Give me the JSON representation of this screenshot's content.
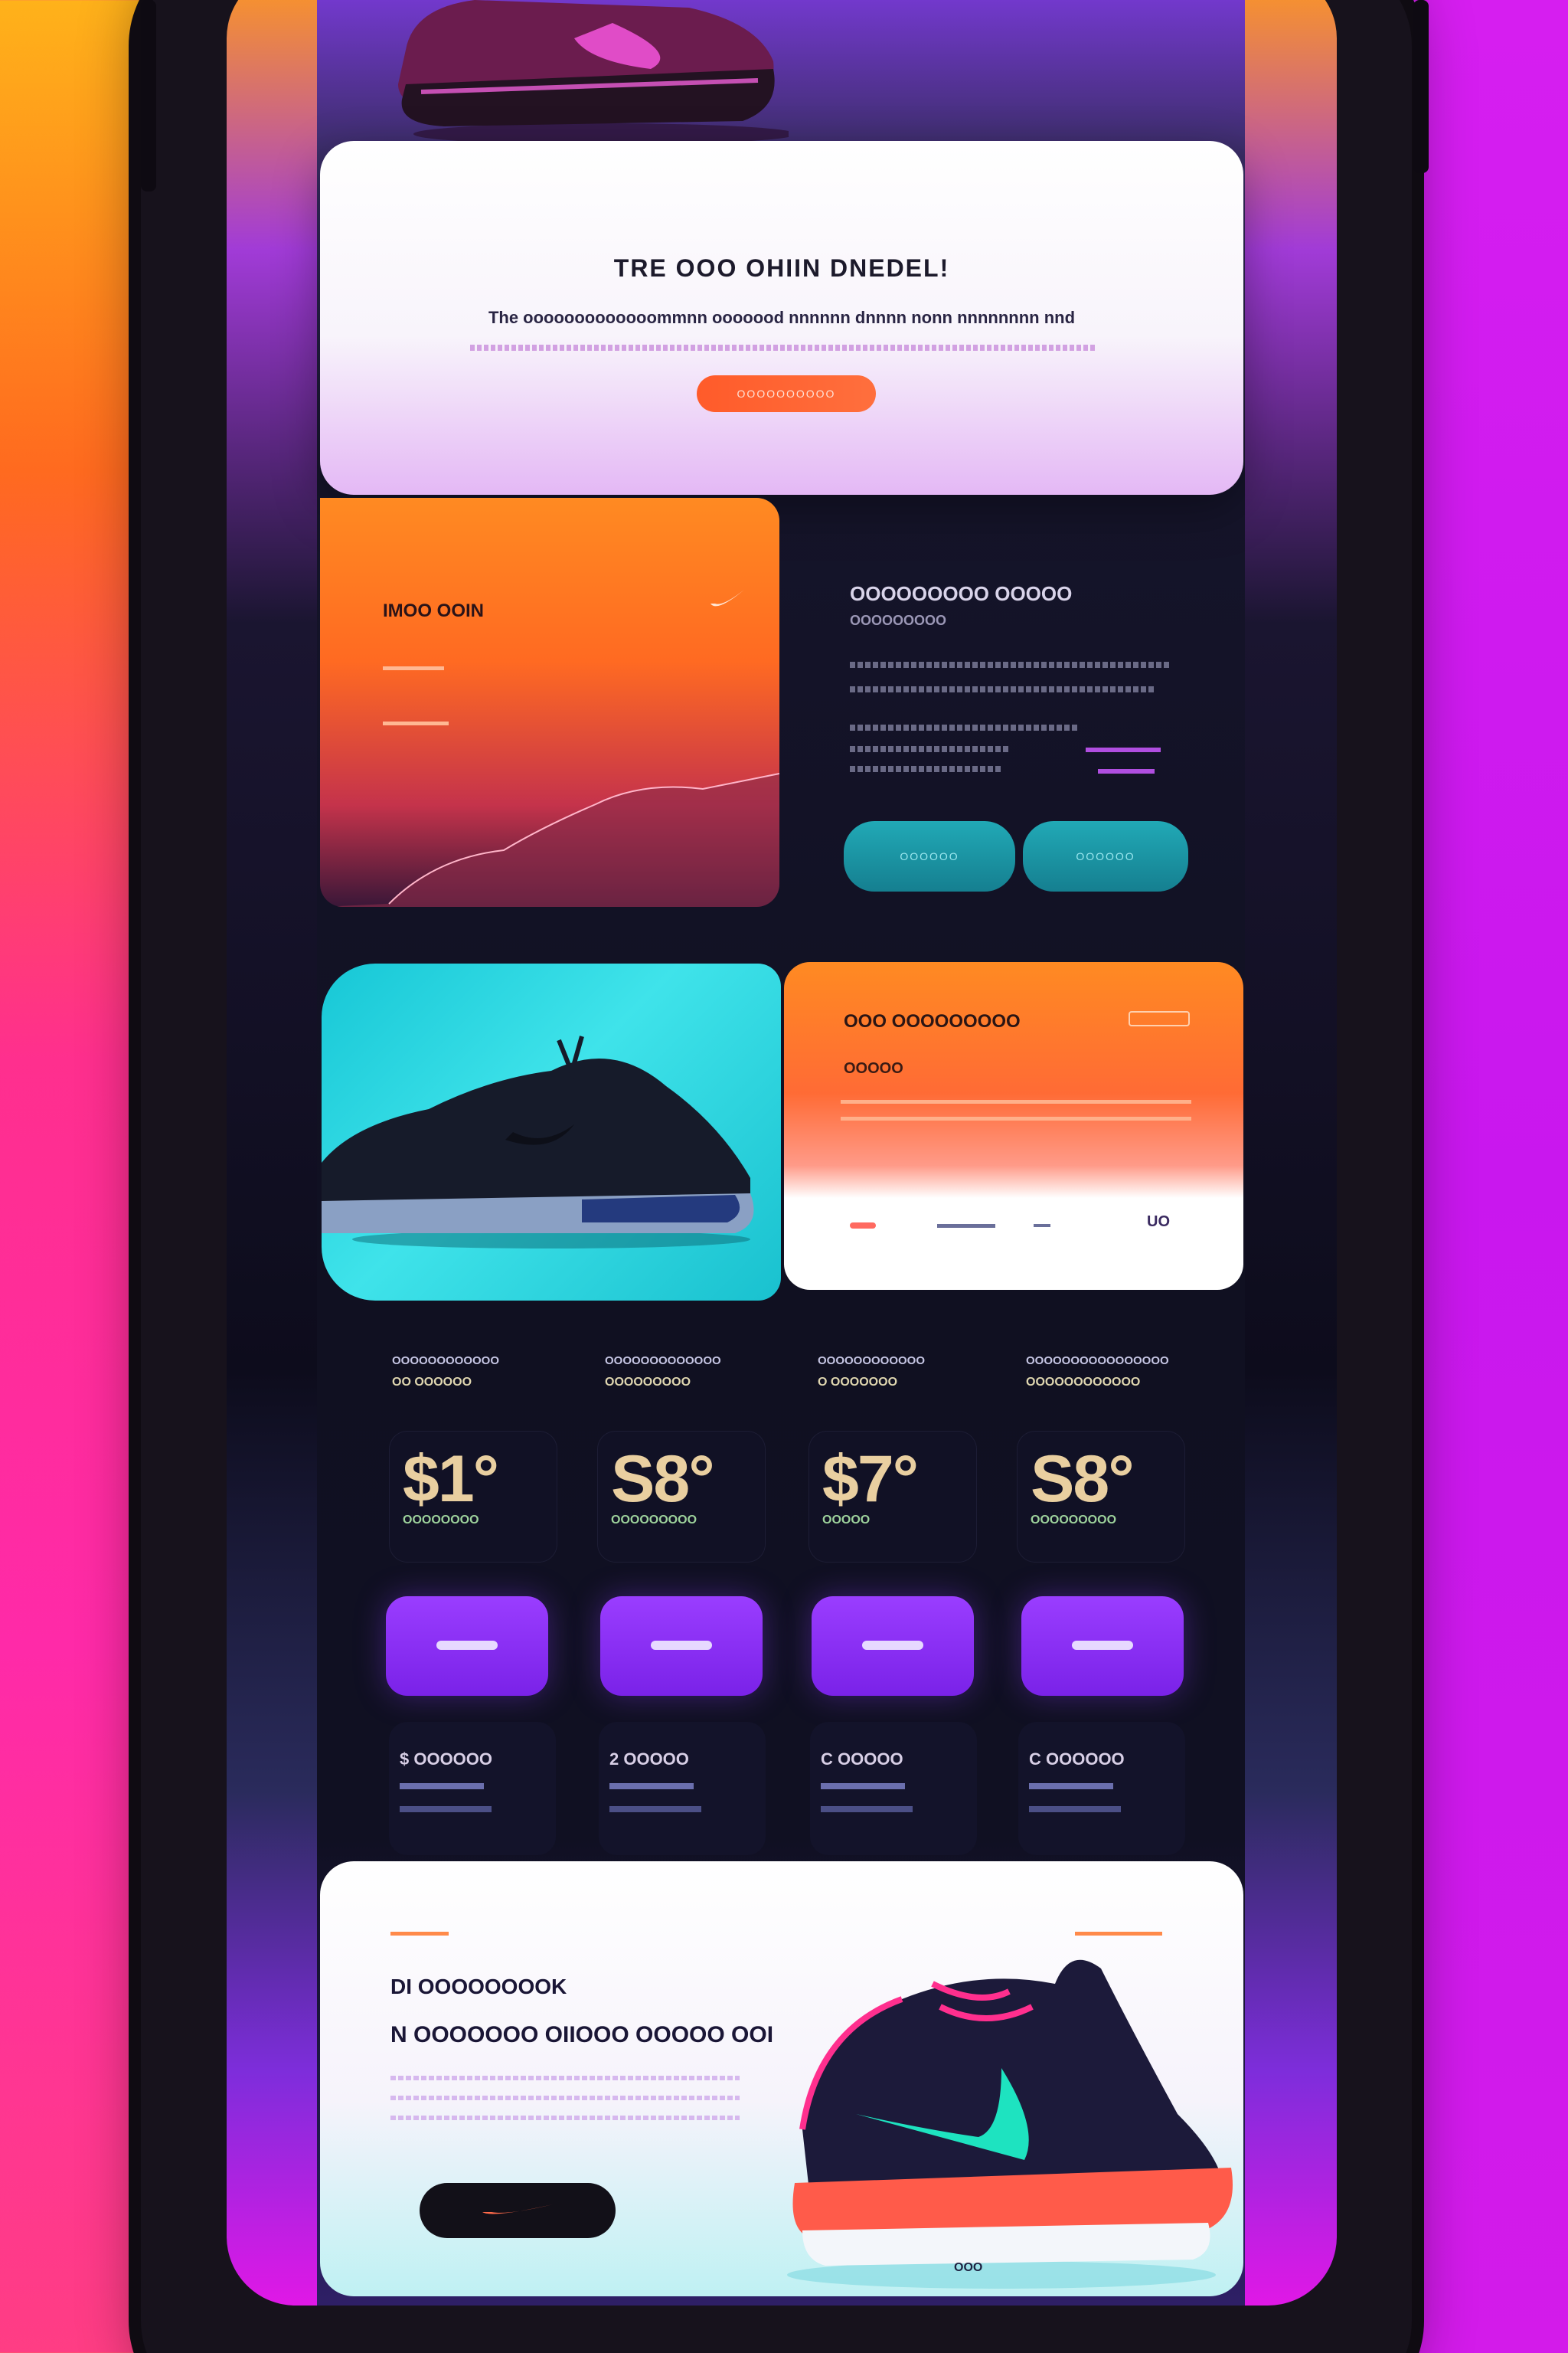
{
  "hero": {
    "title": "TRE OOO OHIIN DNEDEL!",
    "subtitle": "The ooooooooooooommnn ooooood nnnnnn dnnnn nonn nnnnnnnn nnd",
    "cta_label": "OOOOOOOOOO"
  },
  "feature_card": {
    "title": "IMOO OOIN",
    "checkmark_icon": "swoosh-icon"
  },
  "info_panel": {
    "title": "OOOOOOOOO OOOOO",
    "subtitle": "OOOOOOOOO",
    "button_1": "OOOOOO",
    "button_2": "OOOOOO"
  },
  "promo": {
    "title": "OOO OOOOOOOOO",
    "subtitle": "OOOOO",
    "code": "UO"
  },
  "plans": [
    {
      "head": "OOOOOOOOOOOO",
      "sub": "OO OOOOOO",
      "price": "$1°",
      "note": "OOOOOOOO"
    },
    {
      "head": "OOOOOOOOOOOOO",
      "sub": "OOOOOOOOO",
      "price": "S8°",
      "note": "OOOOOOOOO"
    },
    {
      "head": "OOOOOOOOOOOO",
      "sub": "O OOOOOOO",
      "price": "$7°",
      "note": "OOOOO"
    },
    {
      "head": "OOOOOOOOOOOOOOOO",
      "sub": "OOOOOOOOOOOO",
      "price": "S8°",
      "note": "OOOOOOOOO"
    }
  ],
  "mini": [
    {
      "label": "$ OOOOOO"
    },
    {
      "label": "2 OOOOO"
    },
    {
      "label": "C OOOOO"
    },
    {
      "label": "C OOOOOO"
    }
  ],
  "bottom": {
    "heading": "DI OOOOOOOOK",
    "subheading": "N OOOOOOO OIIOOO OOOOO OOI",
    "shoe_badge": "OOO"
  },
  "colors": {
    "accent_orange": "#ff5b2a",
    "accent_purple": "#8a2ff0",
    "accent_cyan": "#19b8c6"
  }
}
